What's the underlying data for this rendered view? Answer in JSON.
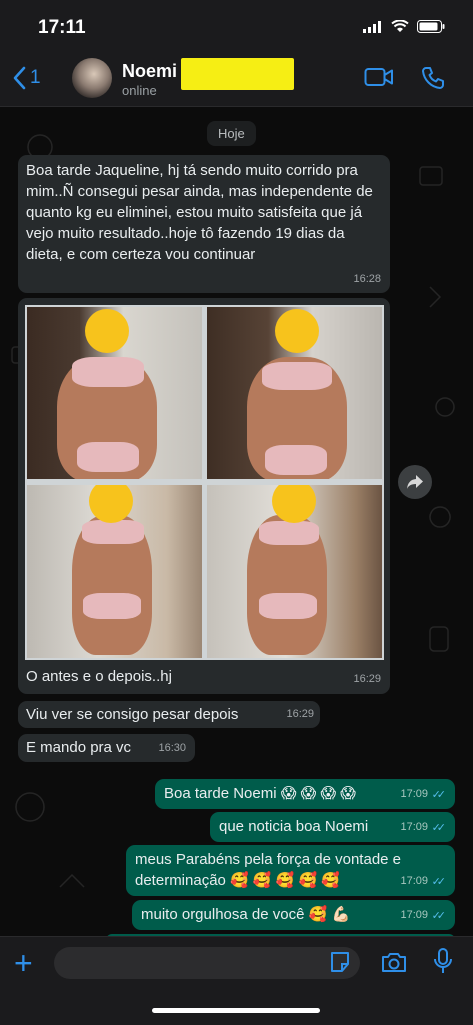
{
  "status": {
    "time": "17:11"
  },
  "header": {
    "back_count": "1",
    "contact_name": "Noemi",
    "contact_status": "online"
  },
  "chat": {
    "date_label": "Hoje",
    "messages": [
      {
        "text": "Boa tarde Jaqueline, hj tá sendo muito corrido pra mim..Ñ consegui pesar ainda, mas independente de quanto kg eu eliminei, estou muito satisfeita que já vejo muito resultado..hoje tô fazendo 19 dias da dieta, e com certeza vou continuar",
        "time": "16:28"
      },
      {
        "caption": "O antes e o depois..hj",
        "time": "16:29"
      },
      {
        "text": "Viu ver se consigo pesar depois",
        "time": "16:29"
      },
      {
        "text": "E mando pra vc",
        "time": "16:30"
      },
      {
        "text": "Boa tarde Noemi 😱 😱 😱 😱",
        "time": "17:09"
      },
      {
        "text": "que noticia boa Noemi",
        "time": "17:09"
      },
      {
        "text": "meus Parabéns pela força de vontade e determinação  🥰 🥰 🥰 🥰 🥰",
        "time": "17:09"
      },
      {
        "text": "muito orgulhosa de você 🥰 💪🏻",
        "time": "17:09"
      }
    ]
  },
  "colors": {
    "incoming_bubble": "#262a2c",
    "outgoing_bubble": "#005c4b",
    "accent": "#2f8fe8",
    "read_ticks": "#53bdeb"
  },
  "icons": [
    "back-chevron-icon",
    "video-call-icon",
    "phone-icon",
    "forward-icon",
    "plus-icon",
    "sticker-icon",
    "camera-icon",
    "mic-icon",
    "signal-icon",
    "wifi-icon",
    "battery-icon"
  ]
}
